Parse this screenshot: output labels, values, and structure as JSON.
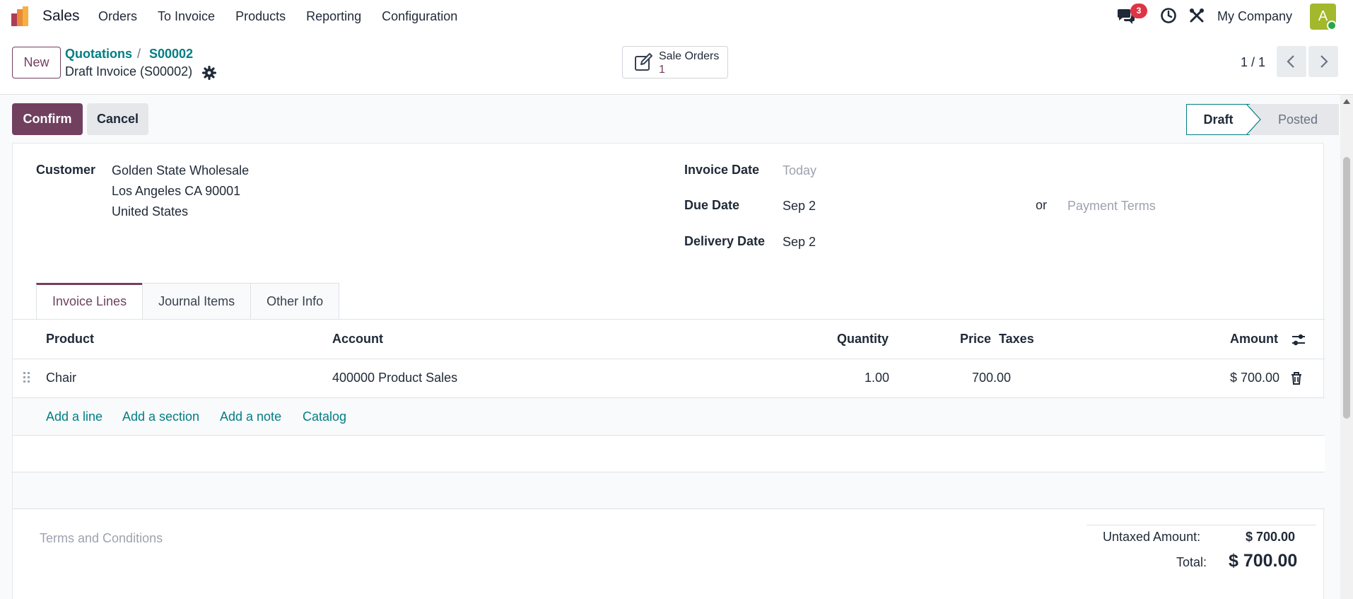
{
  "navbar": {
    "app_name": "Sales",
    "menu": [
      "Orders",
      "To Invoice",
      "Products",
      "Reporting",
      "Configuration"
    ],
    "chat_count": "3",
    "company": "My Company",
    "avatar_letter": "A"
  },
  "control": {
    "new_label": "New",
    "breadcrumb_parent": "Quotations",
    "breadcrumb_separator": "/",
    "breadcrumb_child": "S00002",
    "record_title": "Draft Invoice (S00002)",
    "smart_button": {
      "label": "Sale Orders",
      "count": "1"
    },
    "pager": "1 / 1"
  },
  "statusbar": {
    "confirm_label": "Confirm",
    "cancel_label": "Cancel",
    "stages": [
      "Draft",
      "Posted"
    ],
    "active_stage": "Draft"
  },
  "form": {
    "customer_label": "Customer",
    "customer_lines": [
      "Golden State Wholesale",
      "Los Angeles CA 90001",
      "United States"
    ],
    "invoice_date_label": "Invoice Date",
    "invoice_date_placeholder": "Today",
    "due_date_label": "Due Date",
    "due_date_value": "Sep 2",
    "or_label": "or",
    "payment_terms_placeholder": "Payment Terms",
    "delivery_date_label": "Delivery Date",
    "delivery_date_value": "Sep 2"
  },
  "tabs": [
    "Invoice Lines",
    "Journal Items",
    "Other Info"
  ],
  "lines": {
    "headers": {
      "product": "Product",
      "account": "Account",
      "quantity": "Quantity",
      "price": "Price",
      "taxes": "Taxes",
      "amount": "Amount"
    },
    "rows": [
      {
        "product": "Chair",
        "account": "400000 Product Sales",
        "quantity": "1.00",
        "price": "700.00",
        "taxes": "",
        "amount": "$ 700.00"
      }
    ],
    "actions": [
      "Add a line",
      "Add a section",
      "Add a note",
      "Catalog"
    ]
  },
  "footer": {
    "terms_placeholder": "Terms and Conditions",
    "untaxed_label": "Untaxed Amount:",
    "untaxed_value": "$ 700.00",
    "total_label": "Total:",
    "total_value": "$ 700.00"
  },
  "colors": {
    "primary": "#71405f",
    "link": "#017e84",
    "danger": "#dc3545"
  }
}
